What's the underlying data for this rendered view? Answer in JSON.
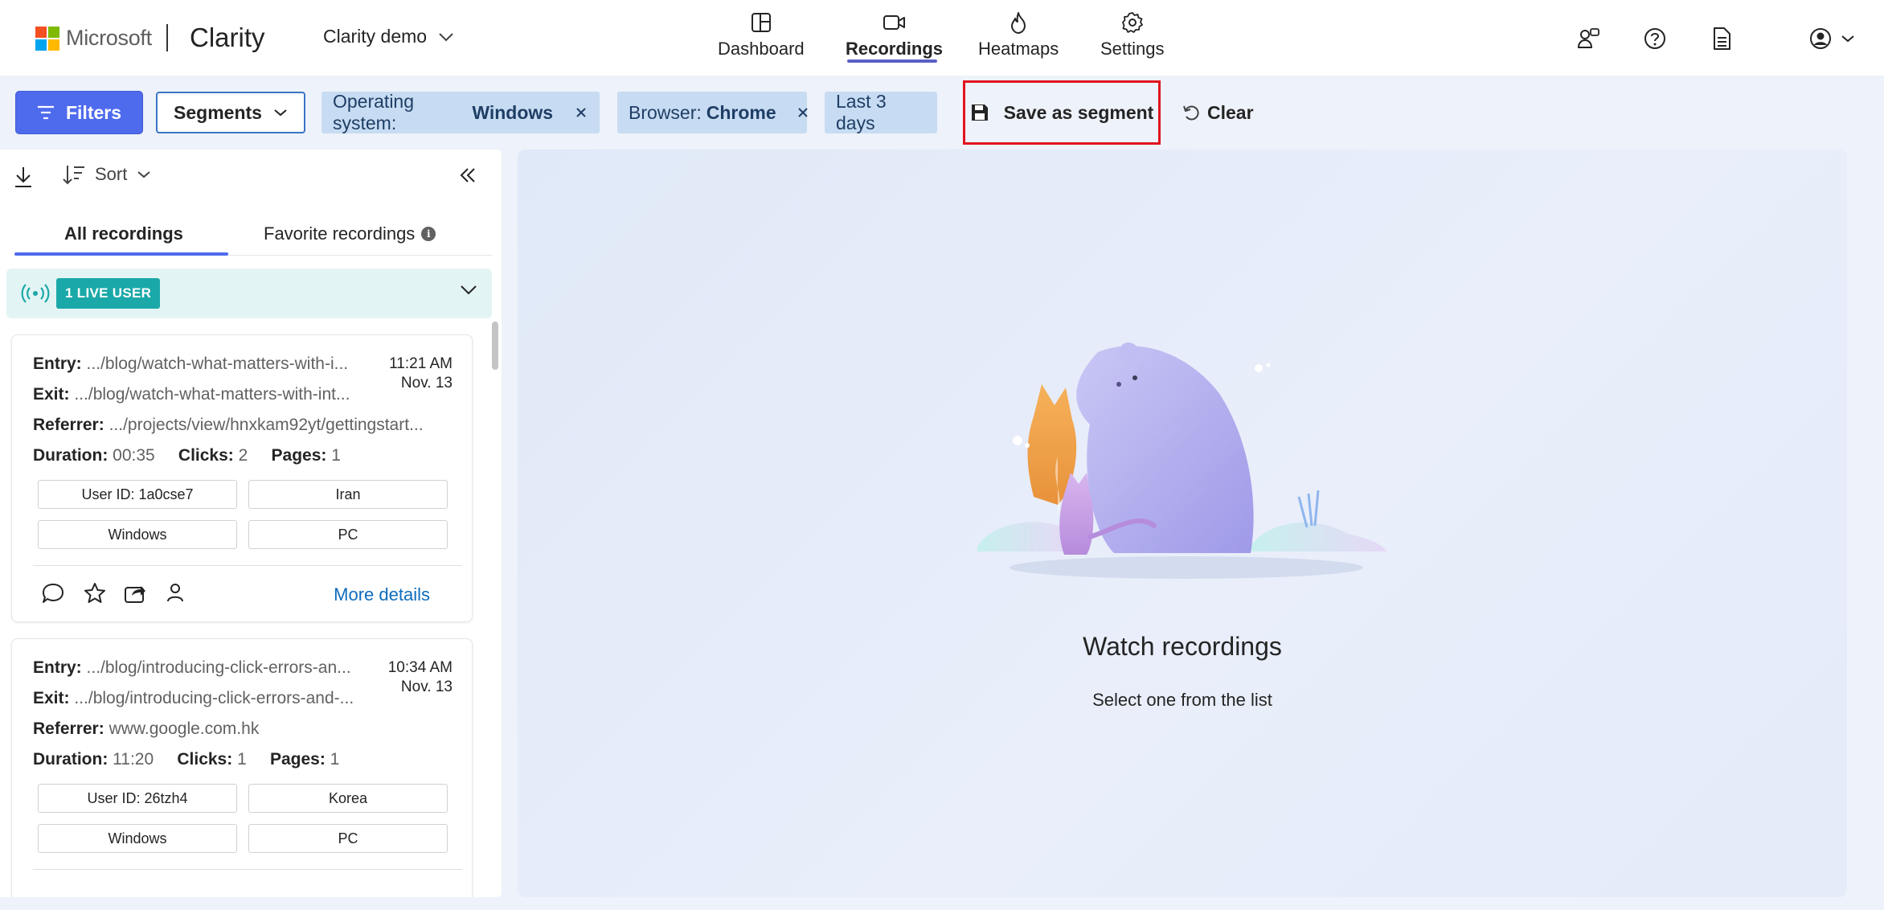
{
  "header": {
    "ms_word": "Microsoft",
    "app_name": "Clarity",
    "project": "Clarity demo",
    "nav": [
      {
        "label": "Dashboard",
        "icon": "dashboard-icon"
      },
      {
        "label": "Recordings",
        "icon": "video-camera-icon",
        "active": true
      },
      {
        "label": "Heatmaps",
        "icon": "flame-icon"
      },
      {
        "label": "Settings",
        "icon": "gear-icon"
      }
    ],
    "right_icons": [
      "people-feedback-icon",
      "help-icon",
      "document-icon",
      "account-icon"
    ]
  },
  "filters": {
    "filters_label": "Filters",
    "segments_label": "Segments",
    "chips": [
      {
        "key": "Operating system:",
        "value": "Windows"
      },
      {
        "key": "Browser:",
        "value": "Chrome"
      },
      {
        "key": "Last 3 days",
        "value": ""
      }
    ],
    "save_segment_label": "Save as segment",
    "clear_label": "Clear"
  },
  "left_panel": {
    "sort_label": "Sort",
    "tabs": [
      "All recordings",
      "Favorite recordings"
    ],
    "live_badge": "1 LIVE USER",
    "recordings": [
      {
        "entry_label": "Entry:",
        "entry": ".../blog/watch-what-matters-with-i...",
        "exit_label": "Exit:",
        "exit": ".../blog/watch-what-matters-with-int...",
        "referrer_label": "Referrer:",
        "referrer": ".../projects/view/hnxkam92yt/gettingstart...",
        "duration_label": "Duration:",
        "duration": "00:35",
        "clicks_label": "Clicks:",
        "clicks": "2",
        "pages_label": "Pages:",
        "pages": "1",
        "time": "11:21 AM",
        "date": "Nov. 13",
        "tags": [
          "User ID: 1a0cse7",
          "Iran",
          "Windows",
          "PC"
        ],
        "more": "More details"
      },
      {
        "entry_label": "Entry:",
        "entry": ".../blog/introducing-click-errors-an...",
        "exit_label": "Exit:",
        "exit": ".../blog/introducing-click-errors-and-...",
        "referrer_label": "Referrer:",
        "referrer": "www.google.com.hk",
        "duration_label": "Duration:",
        "duration": "11:20",
        "clicks_label": "Clicks:",
        "clicks": "1",
        "pages_label": "Pages:",
        "pages": "1",
        "time": "10:34 AM",
        "date": "Nov. 13",
        "tags": [
          "User ID: 26tzh4",
          "Korea",
          "Windows",
          "PC"
        ],
        "more": "More details"
      }
    ]
  },
  "main": {
    "title": "Watch recordings",
    "subtitle": "Select one from the list"
  },
  "colors": {
    "accent": "#4f6bed",
    "chip_bg": "#c7dcf2",
    "highlight_border": "#e0141e",
    "live_teal": "#1ba8a8",
    "link": "#0f6cbd"
  }
}
